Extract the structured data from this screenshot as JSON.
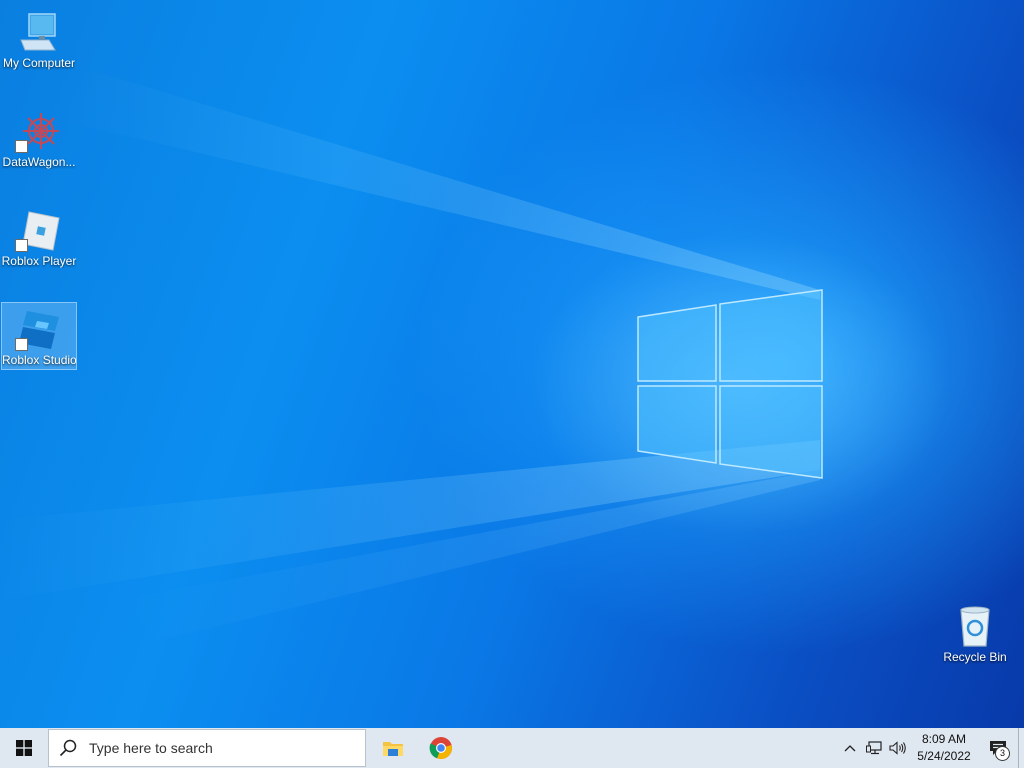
{
  "desktop": {
    "icons": [
      {
        "label": "My Computer",
        "icon": "computer-icon"
      },
      {
        "label": "DataWagon...",
        "icon": "datawagon-icon",
        "shortcut": true
      },
      {
        "label": "Roblox Player",
        "icon": "roblox-player-icon",
        "shortcut": true
      },
      {
        "label": "Roblox Studio",
        "icon": "roblox-studio-icon",
        "shortcut": true,
        "selected": true
      },
      {
        "label": "Recycle Bin",
        "icon": "recycle-bin-icon"
      }
    ]
  },
  "taskbar": {
    "search_placeholder": "Type here to search",
    "pinned": [
      {
        "icon": "file-explorer-icon"
      },
      {
        "icon": "chrome-icon"
      }
    ],
    "tray": {
      "time": "8:09 AM",
      "date": "5/24/2022",
      "notification_count": "3"
    }
  },
  "colors": {
    "taskbar_bg": "#dfe7f0",
    "wallpaper_accent": "#1ea3ff"
  }
}
